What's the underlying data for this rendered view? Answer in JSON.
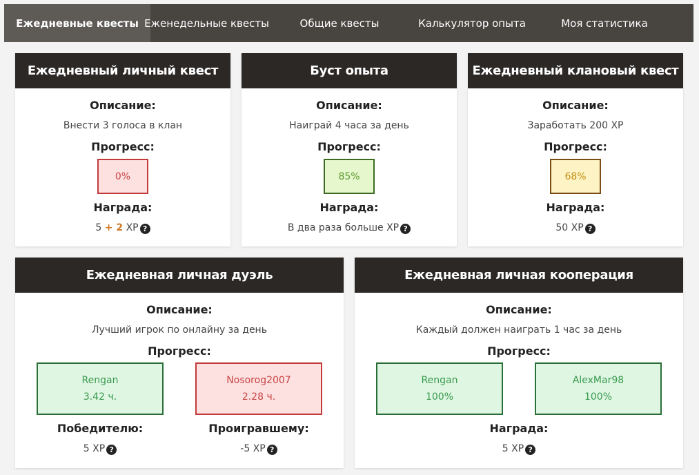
{
  "nav": {
    "tabs": [
      {
        "label": "Ежедневные квесты",
        "active": true
      },
      {
        "label": "Еженедельные квесты",
        "active": false
      },
      {
        "label": "Общие квесты",
        "active": false
      },
      {
        "label": "Калькулятор опыта",
        "active": false
      },
      {
        "label": "Моя статистика",
        "active": false
      }
    ]
  },
  "labels": {
    "description": "Описание:",
    "progress": "Прогресс:",
    "reward": "Награда:",
    "winner": "Победителю:",
    "loser": "Проигравшему:"
  },
  "cards": {
    "personal": {
      "title": "Ежедневный личный квест",
      "description": "Внести 3 голоса в клан",
      "progress": "0%",
      "reward_base": "5",
      "reward_bonus": "+ 2",
      "reward_unit": "XP"
    },
    "boost": {
      "title": "Буст опыта",
      "description": "Наиграй 4 часа за день",
      "progress": "85%",
      "reward": "В два раза больше XP"
    },
    "clan": {
      "title": "Ежедневный клановый квест",
      "description": "Заработать 200 XP",
      "progress": "68%",
      "reward": "50 XP"
    },
    "duel": {
      "title": "Ежедневная личная дуэль",
      "description": "Лучший игрок по онлайну за день",
      "player1": {
        "name": "Rengan",
        "value": "3.42 ч."
      },
      "player2": {
        "name": "Nosorog2007",
        "value": "2.28 ч."
      },
      "winner_reward": "5 XP",
      "loser_reward": "-5 XP"
    },
    "coop": {
      "title": "Ежедневная личная кооперация",
      "description": "Каждый должен наиграть 1 час за день",
      "player1": {
        "name": "Rengan",
        "value": "100%"
      },
      "player2": {
        "name": "AlexMar98",
        "value": "100%"
      },
      "reward": "5 XP"
    }
  },
  "icons": {
    "help": "question-circle-icon"
  },
  "colors": {
    "nav_bg": "#484541",
    "header_bg": "#2b2826",
    "red": "#c23a3a",
    "green": "#3d6b22",
    "yellow": "#7a4d14",
    "mint": "#2b6f38",
    "bonus": "#d07a2a"
  }
}
